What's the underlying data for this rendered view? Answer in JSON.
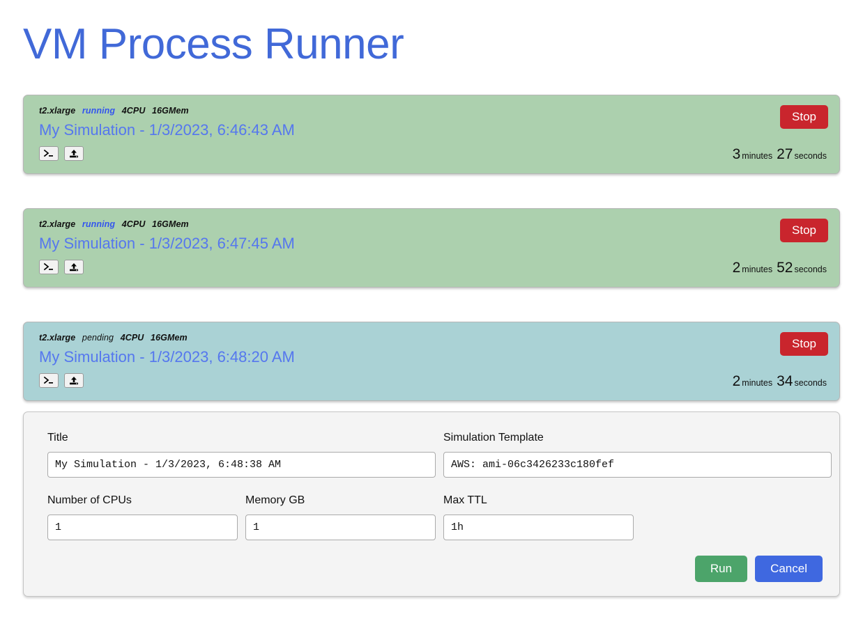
{
  "app": {
    "title": "VM Process Runner",
    "title_color": "#4169D8"
  },
  "colors": {
    "running_card": "#ACD0AE",
    "pending_card": "#AAD2D5",
    "stop_button": "#C9252D",
    "run_button": "#4CA46A",
    "cancel_button": "#3F68E0",
    "link": "#5577EE",
    "panel_background": "#F4F4F4"
  },
  "vms": [
    {
      "instance_type": "t2.xlarge",
      "status": "running",
      "cpu": "4CPU",
      "memory": "16GMem",
      "name": "My Simulation - 1/3/2023, 6:46:43 AM",
      "stop_label": "Stop",
      "terminal_icon": "terminal-icon",
      "upload_icon": "upload-icon",
      "elapsed": {
        "minutes": "3",
        "minutes_unit": "minutes",
        "seconds": "27",
        "seconds_unit": "seconds"
      }
    },
    {
      "instance_type": "t2.xlarge",
      "status": "running",
      "cpu": "4CPU",
      "memory": "16GMem",
      "name": "My Simulation - 1/3/2023, 6:47:45 AM",
      "stop_label": "Stop",
      "terminal_icon": "terminal-icon",
      "upload_icon": "upload-icon",
      "elapsed": {
        "minutes": "2",
        "minutes_unit": "minutes",
        "seconds": "52",
        "seconds_unit": "seconds"
      }
    },
    {
      "instance_type": "t2.xlarge",
      "status": "pending",
      "cpu": "4CPU",
      "memory": "16GMem",
      "name": "My Simulation - 1/3/2023, 6:48:20 AM",
      "stop_label": "Stop",
      "terminal_icon": "terminal-icon",
      "upload_icon": "upload-icon",
      "elapsed": {
        "minutes": "2",
        "minutes_unit": "minutes",
        "seconds": "34",
        "seconds_unit": "seconds"
      }
    }
  ],
  "form": {
    "title_field": {
      "label": "Title",
      "value": "My Simulation - 1/3/2023, 6:48:38 AM",
      "placeholder": "Title"
    },
    "template_field": {
      "label": "Simulation Template",
      "value": "AWS: ami-06c3426233c180fef",
      "placeholder": "Simulation Template"
    },
    "cpus_field": {
      "label": "Number of CPUs",
      "value": "1",
      "placeholder": "Number of CPUs"
    },
    "memory_field": {
      "label": "Memory GB",
      "value": "1",
      "placeholder": "Memory GB"
    },
    "ttl_field": {
      "label": "Max TTL",
      "value": "1h",
      "placeholder": "Max TTL"
    },
    "run_label": "Run",
    "cancel_label": "Cancel"
  }
}
